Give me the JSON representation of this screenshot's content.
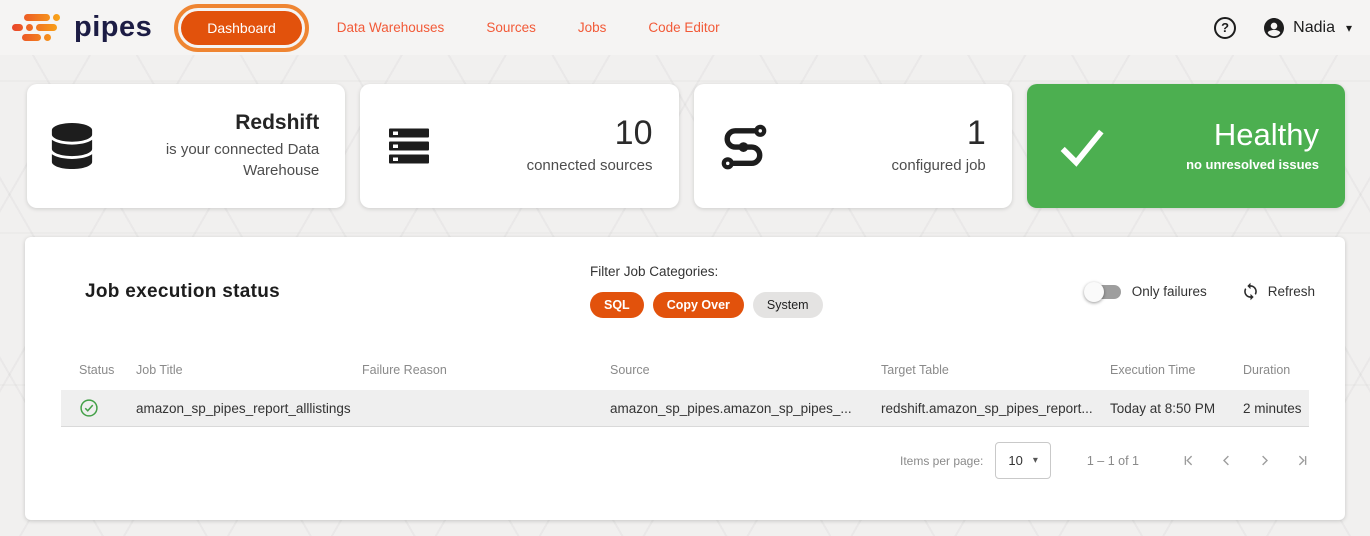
{
  "brand": {
    "name": "pipes"
  },
  "nav": {
    "items": [
      {
        "label": "Dashboard",
        "active": true
      },
      {
        "label": "Data Warehouses",
        "active": false
      },
      {
        "label": "Sources",
        "active": false
      },
      {
        "label": "Jobs",
        "active": false
      },
      {
        "label": "Code Editor",
        "active": false
      }
    ],
    "user": {
      "name": "Nadia"
    }
  },
  "icons": {
    "help_glyph": "?",
    "caret_down_glyph": "▾"
  },
  "cards": [
    {
      "icon": "database-icon",
      "title": "Redshift",
      "subtitle": "is your connected Data Warehouse"
    },
    {
      "icon": "sources-icon",
      "title": "10",
      "subtitle": "connected sources"
    },
    {
      "icon": "pipeline-icon",
      "title": "1",
      "subtitle": "configured job"
    },
    {
      "icon": "check-icon",
      "title": "Healthy",
      "subtitle": "no unresolved issues",
      "variant": "success"
    }
  ],
  "job_section": {
    "title": "Job execution status",
    "filter_label": "Filter Job Categories:",
    "filters": [
      {
        "label": "SQL",
        "active": true
      },
      {
        "label": "Copy Over",
        "active": true
      },
      {
        "label": "System",
        "active": false
      }
    ],
    "only_failures_label": "Only failures",
    "only_failures_on": false,
    "refresh_label": "Refresh",
    "table": {
      "columns": [
        "Status",
        "Job Title",
        "Failure Reason",
        "Source",
        "Target Table",
        "Execution Time",
        "Duration"
      ],
      "rows": [
        {
          "status": "success",
          "job_title": "amazon_sp_pipes_report_alllistings",
          "failure_reason": "",
          "source": "amazon_sp_pipes.amazon_sp_pipes_...",
          "target_table": "redshift.amazon_sp_pipes_report...",
          "execution_time": "Today at 8:50 PM",
          "duration": "2 minutes"
        }
      ]
    },
    "pagination": {
      "items_per_page_label": "Items per page:",
      "items_per_page_value": "10",
      "range_label": "1 – 1 of 1"
    }
  },
  "colors": {
    "accent_orange": "#e2520c",
    "nav_link_orange": "#f25a38",
    "annotation_orange": "#ef8532",
    "success_green": "#4caf50",
    "status_check_green": "#43a047",
    "row_background": "#efefef"
  }
}
